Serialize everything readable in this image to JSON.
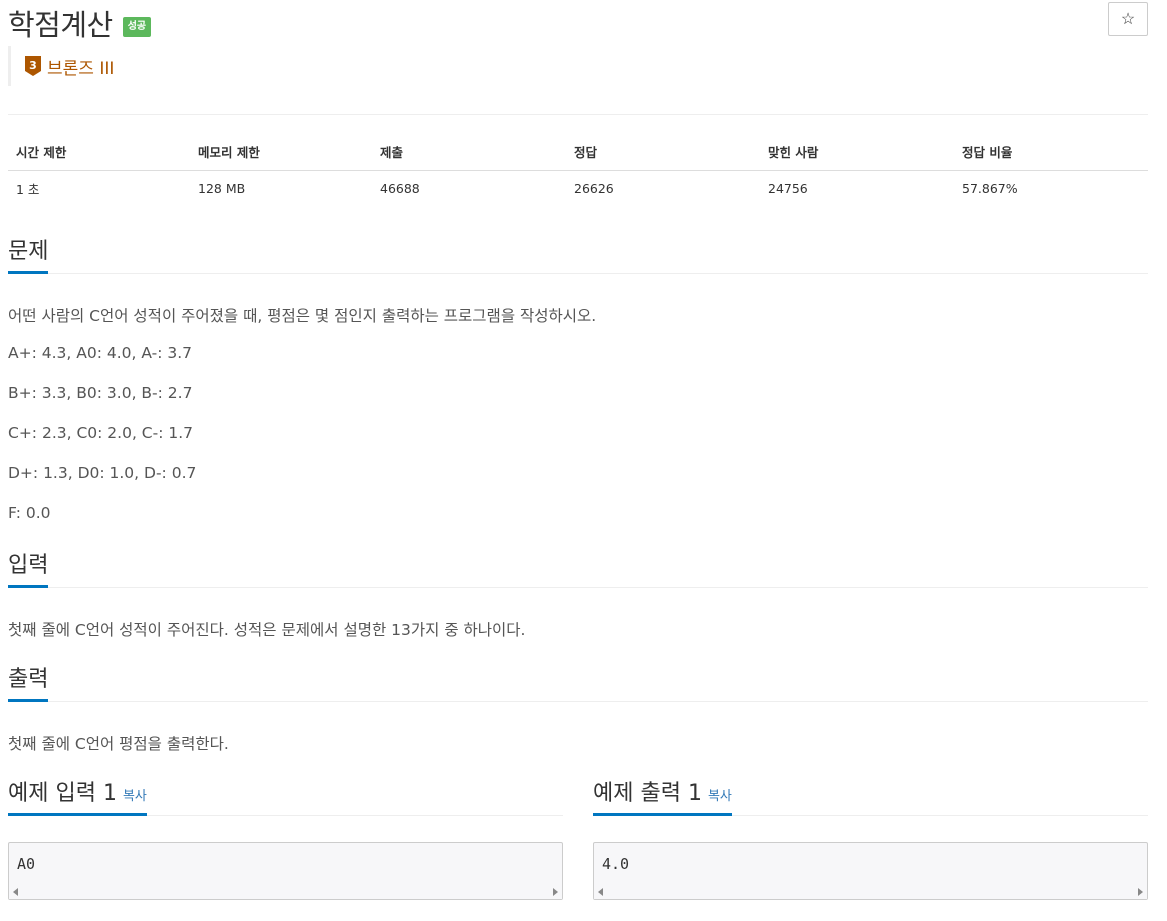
{
  "problem": {
    "title": "학점계산",
    "status_badge": "성공",
    "tier_label": "브론즈 III",
    "tier_number": "3",
    "star_icon": "☆"
  },
  "info_table": {
    "headers": [
      "시간 제한",
      "메모리 제한",
      "제출",
      "정답",
      "맞힌 사람",
      "정답 비율"
    ],
    "values": [
      "1 초",
      "128 MB",
      "46688",
      "26626",
      "24756",
      "57.867%"
    ]
  },
  "sections": {
    "problem": {
      "title": "문제",
      "lines": [
        "어떤 사람의 C언어 성적이 주어졌을 때, 평점은 몇 점인지 출력하는 프로그램을 작성하시오.",
        "A+: 4.3, A0: 4.0, A-: 3.7",
        "B+: 3.3, B0: 3.0, B-: 2.7",
        "C+: 2.3, C0: 2.0, C-: 1.7",
        "D+: 1.3, D0: 1.0, D-: 0.7",
        "F: 0.0"
      ]
    },
    "input": {
      "title": "입력",
      "text": "첫째 줄에 C언어 성적이 주어진다. 성적은 문제에서 설명한 13가지 중 하나이다."
    },
    "output": {
      "title": "출력",
      "text": "첫째 줄에 C언어 평점을 출력한다."
    },
    "sample_input": {
      "title": "예제 입력 1",
      "copy_label": "복사",
      "code": "A0"
    },
    "sample_output": {
      "title": "예제 출력 1",
      "copy_label": "복사",
      "code": "4.0"
    }
  },
  "colors": {
    "success_badge": "#5cb85c",
    "bronze": "#ad5600",
    "section_accent": "#0076c0",
    "link": "#337ab7"
  }
}
